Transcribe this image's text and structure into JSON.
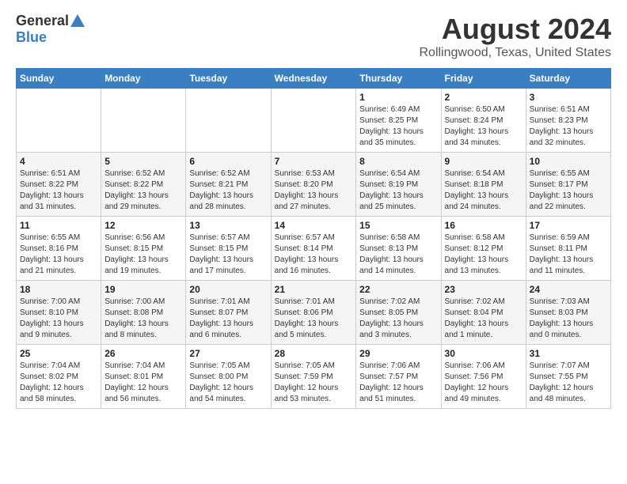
{
  "header": {
    "logo_general": "General",
    "logo_blue": "Blue",
    "title": "August 2024",
    "subtitle": "Rollingwood, Texas, United States"
  },
  "calendar": {
    "days_of_week": [
      "Sunday",
      "Monday",
      "Tuesday",
      "Wednesday",
      "Thursday",
      "Friday",
      "Saturday"
    ],
    "rows": [
      {
        "row_class": "row-odd",
        "cells": [
          {
            "empty": true
          },
          {
            "empty": true
          },
          {
            "empty": true
          },
          {
            "empty": true
          },
          {
            "day": "1",
            "sunrise": "6:49 AM",
            "sunset": "8:25 PM",
            "daylight": "13 hours and 35 minutes."
          },
          {
            "day": "2",
            "sunrise": "6:50 AM",
            "sunset": "8:24 PM",
            "daylight": "13 hours and 34 minutes."
          },
          {
            "day": "3",
            "sunrise": "6:51 AM",
            "sunset": "8:23 PM",
            "daylight": "13 hours and 32 minutes."
          }
        ]
      },
      {
        "row_class": "row-even",
        "cells": [
          {
            "day": "4",
            "sunrise": "6:51 AM",
            "sunset": "8:22 PM",
            "daylight": "13 hours and 31 minutes."
          },
          {
            "day": "5",
            "sunrise": "6:52 AM",
            "sunset": "8:22 PM",
            "daylight": "13 hours and 29 minutes."
          },
          {
            "day": "6",
            "sunrise": "6:52 AM",
            "sunset": "8:21 PM",
            "daylight": "13 hours and 28 minutes."
          },
          {
            "day": "7",
            "sunrise": "6:53 AM",
            "sunset": "8:20 PM",
            "daylight": "13 hours and 27 minutes."
          },
          {
            "day": "8",
            "sunrise": "6:54 AM",
            "sunset": "8:19 PM",
            "daylight": "13 hours and 25 minutes."
          },
          {
            "day": "9",
            "sunrise": "6:54 AM",
            "sunset": "8:18 PM",
            "daylight": "13 hours and 24 minutes."
          },
          {
            "day": "10",
            "sunrise": "6:55 AM",
            "sunset": "8:17 PM",
            "daylight": "13 hours and 22 minutes."
          }
        ]
      },
      {
        "row_class": "row-odd",
        "cells": [
          {
            "day": "11",
            "sunrise": "6:55 AM",
            "sunset": "8:16 PM",
            "daylight": "13 hours and 21 minutes."
          },
          {
            "day": "12",
            "sunrise": "6:56 AM",
            "sunset": "8:15 PM",
            "daylight": "13 hours and 19 minutes."
          },
          {
            "day": "13",
            "sunrise": "6:57 AM",
            "sunset": "8:15 PM",
            "daylight": "13 hours and 17 minutes."
          },
          {
            "day": "14",
            "sunrise": "6:57 AM",
            "sunset": "8:14 PM",
            "daylight": "13 hours and 16 minutes."
          },
          {
            "day": "15",
            "sunrise": "6:58 AM",
            "sunset": "8:13 PM",
            "daylight": "13 hours and 14 minutes."
          },
          {
            "day": "16",
            "sunrise": "6:58 AM",
            "sunset": "8:12 PM",
            "daylight": "13 hours and 13 minutes."
          },
          {
            "day": "17",
            "sunrise": "6:59 AM",
            "sunset": "8:11 PM",
            "daylight": "13 hours and 11 minutes."
          }
        ]
      },
      {
        "row_class": "row-even",
        "cells": [
          {
            "day": "18",
            "sunrise": "7:00 AM",
            "sunset": "8:10 PM",
            "daylight": "13 hours and 9 minutes."
          },
          {
            "day": "19",
            "sunrise": "7:00 AM",
            "sunset": "8:08 PM",
            "daylight": "13 hours and 8 minutes."
          },
          {
            "day": "20",
            "sunrise": "7:01 AM",
            "sunset": "8:07 PM",
            "daylight": "13 hours and 6 minutes."
          },
          {
            "day": "21",
            "sunrise": "7:01 AM",
            "sunset": "8:06 PM",
            "daylight": "13 hours and 5 minutes."
          },
          {
            "day": "22",
            "sunrise": "7:02 AM",
            "sunset": "8:05 PM",
            "daylight": "13 hours and 3 minutes."
          },
          {
            "day": "23",
            "sunrise": "7:02 AM",
            "sunset": "8:04 PM",
            "daylight": "13 hours and 1 minute."
          },
          {
            "day": "24",
            "sunrise": "7:03 AM",
            "sunset": "8:03 PM",
            "daylight": "13 hours and 0 minutes."
          }
        ]
      },
      {
        "row_class": "row-odd",
        "cells": [
          {
            "day": "25",
            "sunrise": "7:04 AM",
            "sunset": "8:02 PM",
            "daylight": "12 hours and 58 minutes."
          },
          {
            "day": "26",
            "sunrise": "7:04 AM",
            "sunset": "8:01 PM",
            "daylight": "12 hours and 56 minutes."
          },
          {
            "day": "27",
            "sunrise": "7:05 AM",
            "sunset": "8:00 PM",
            "daylight": "12 hours and 54 minutes."
          },
          {
            "day": "28",
            "sunrise": "7:05 AM",
            "sunset": "7:59 PM",
            "daylight": "12 hours and 53 minutes."
          },
          {
            "day": "29",
            "sunrise": "7:06 AM",
            "sunset": "7:57 PM",
            "daylight": "12 hours and 51 minutes."
          },
          {
            "day": "30",
            "sunrise": "7:06 AM",
            "sunset": "7:56 PM",
            "daylight": "12 hours and 49 minutes."
          },
          {
            "day": "31",
            "sunrise": "7:07 AM",
            "sunset": "7:55 PM",
            "daylight": "12 hours and 48 minutes."
          }
        ]
      }
    ]
  }
}
